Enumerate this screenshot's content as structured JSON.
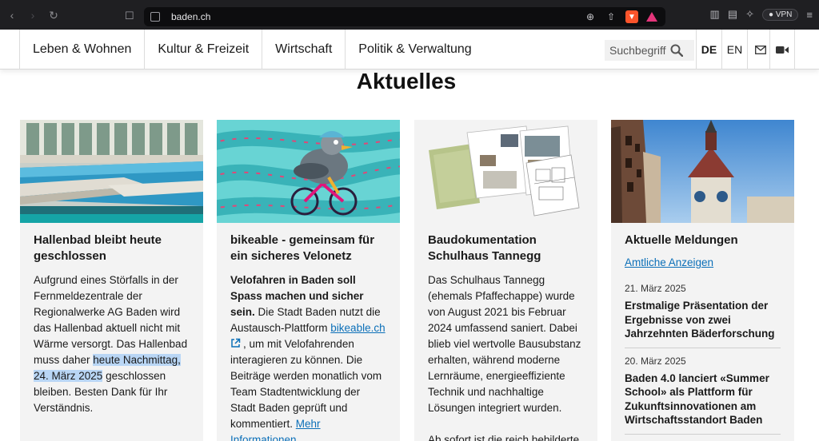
{
  "browser": {
    "url": "baden.ch"
  },
  "nav": {
    "items": [
      "Leben & Wohnen",
      "Kultur & Freizeit",
      "Wirtschaft",
      "Politik & Verwaltung"
    ],
    "search_placeholder": "Suchbegriff",
    "lang_de": "DE",
    "lang_en": "EN"
  },
  "section_title": "Aktuelles",
  "cards": [
    {
      "title": "Hallenbad bleibt heute geschlossen",
      "text_before": "Aufgrund eines Störfalls in der Fernmeldezentrale der Regionalwerke AG Baden wird das Hallenbad aktuell nicht mit Wärme versorgt. Das Hallenbad muss daher ",
      "text_highlight": "heute Nachmittag, 24. März 2025",
      "text_after": " geschlossen bleiben. Besten Dank für Ihr Verständnis."
    },
    {
      "title": "bikeable - gemeinsam für ein sicheres Velonetz",
      "lead": "Velofahren in Baden soll Spass machen und sicher sein.",
      "text_1": " Die Stadt Baden nutzt die Austausch-Plattform ",
      "link": "bikeable.ch",
      "text_2": ", um mit Velofahrenden interagieren zu können. Die Beiträge werden monatlich vom Team Stadtentwicklung der Stadt Baden geprüft und kommentiert. ",
      "more_link": "Mehr Informationen"
    },
    {
      "title": "Baudokumentation Schulhaus Tannegg",
      "text": "Das Schulhaus Tannegg (ehemals Pfaffechappe) wurde von August 2021 bis Februar 2024 umfassend saniert. Dabei blieb viel wertvolle Bausubstanz erhalten, während moderne Lernräume, energieeffiziente Technik und nachhaltige Lösungen integriert wurden.",
      "text_2": "Ab sofort ist die reich bebilderte"
    },
    {
      "title": "Aktuelle Meldungen",
      "link": "Amtliche Anzeigen",
      "news": [
        {
          "date": "21. März 2025",
          "title": "Erstmalige Präsentation der Ergebnisse von zwei Jahrzehnten Bäderforschung"
        },
        {
          "date": "20. März 2025",
          "title": "Baden 4.0 lanciert «Summer School» als Plattform für Zukunftsinnovationen am Wirtschaftsstandort Baden"
        }
      ]
    }
  ],
  "icons": {
    "back": "back-arrow-icon",
    "forward": "forward-arrow-icon",
    "reload": "reload-icon",
    "bookmark": "bookmark-icon",
    "search": "search-icon",
    "mail": "mail-icon",
    "video": "video-camera-icon"
  },
  "colors": {
    "link": "#0b6fb8",
    "highlight": "#b9d6f5",
    "card_bg": "#f3f3f3"
  }
}
